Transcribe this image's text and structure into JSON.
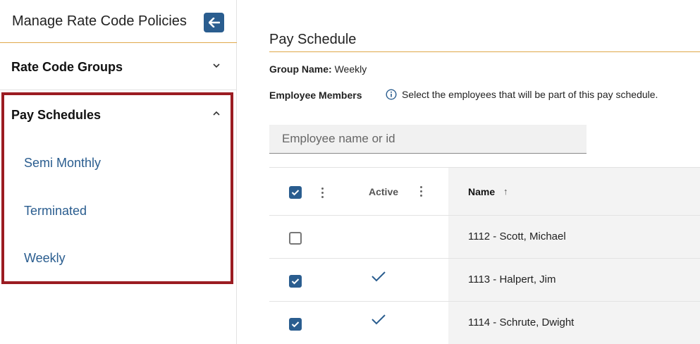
{
  "sidebar": {
    "title": "Manage Rate Code Policies",
    "back_icon": "arrow-left-icon",
    "groups": [
      {
        "label": "Rate Code Groups",
        "expanded": false
      },
      {
        "label": "Pay Schedules",
        "expanded": true,
        "items": [
          "Semi Monthly",
          "Terminated",
          "Weekly"
        ]
      }
    ],
    "highlight_color": "#9b1c22"
  },
  "main": {
    "section_title": "Pay Schedule",
    "group_name_label": "Group Name:",
    "group_name_value": "Weekly",
    "employee_members_label": "Employee Members",
    "info_text": "Select the employees that will be part of this pay schedule.",
    "search_placeholder": "Employee name or id"
  },
  "table": {
    "headers": {
      "active": "Active",
      "name": "Name",
      "sort_indicator": "↑"
    },
    "header_checked": true,
    "rows": [
      {
        "checked": false,
        "active": false,
        "name": "1112 - Scott, Michael"
      },
      {
        "checked": true,
        "active": true,
        "name": "1113 - Halpert, Jim"
      },
      {
        "checked": true,
        "active": true,
        "name": "1114 - Schrute, Dwight"
      }
    ]
  },
  "colors": {
    "accent": "#2a5d8f",
    "rule": "#e0a84a"
  }
}
